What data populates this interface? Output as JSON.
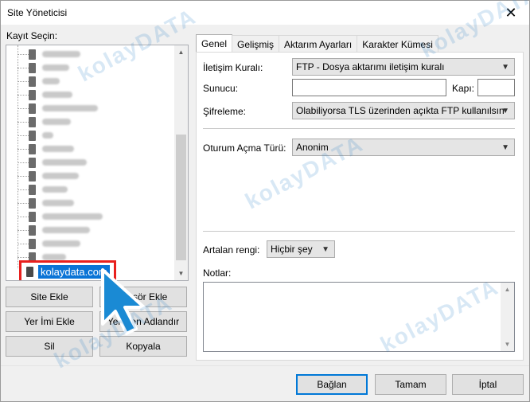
{
  "window": {
    "title": "Site Yöneticisi"
  },
  "left": {
    "tree_label": "Kayıt Seçin:",
    "selected_site": "kolaydata.com"
  },
  "buttons": {
    "site_ekle": "Site Ekle",
    "klasor_ekle": "Klasör Ekle",
    "yer_imi_ekle": "Yer İmi Ekle",
    "yeniden_adlandir": "Yeniden Adlandır",
    "sil": "Sil",
    "kopyala": "Kopyala",
    "baglan": "Bağlan",
    "tamam": "Tamam",
    "iptal": "İptal"
  },
  "tabs": [
    "Genel",
    "Gelişmiş",
    "Aktarım Ayarları",
    "Karakter Kümesi"
  ],
  "genel": {
    "protocol_label": "İletişim Kuralı:",
    "protocol_value": "FTP - Dosya aktarımı iletişim kuralı",
    "host_label": "Sunucu:",
    "host_value": "",
    "port_label": "Kapı:",
    "port_value": "",
    "encryption_label": "Şifreleme:",
    "encryption_value": "Olabiliyorsa TLS üzerinden açıkta FTP kullanılsın",
    "logon_label": "Oturum Açma Türü:",
    "logon_value": "Anonim",
    "bgcolor_label": "Artalan rengi:",
    "bgcolor_value": "Hiçbir şey",
    "notes_label": "Notlar:"
  },
  "watermark": "kolayDATA",
  "colors": {
    "accent": "#0078d7",
    "selection": "#0a74d6",
    "highlight_border": "#e8201e",
    "pointer": "#1a8ad4"
  }
}
